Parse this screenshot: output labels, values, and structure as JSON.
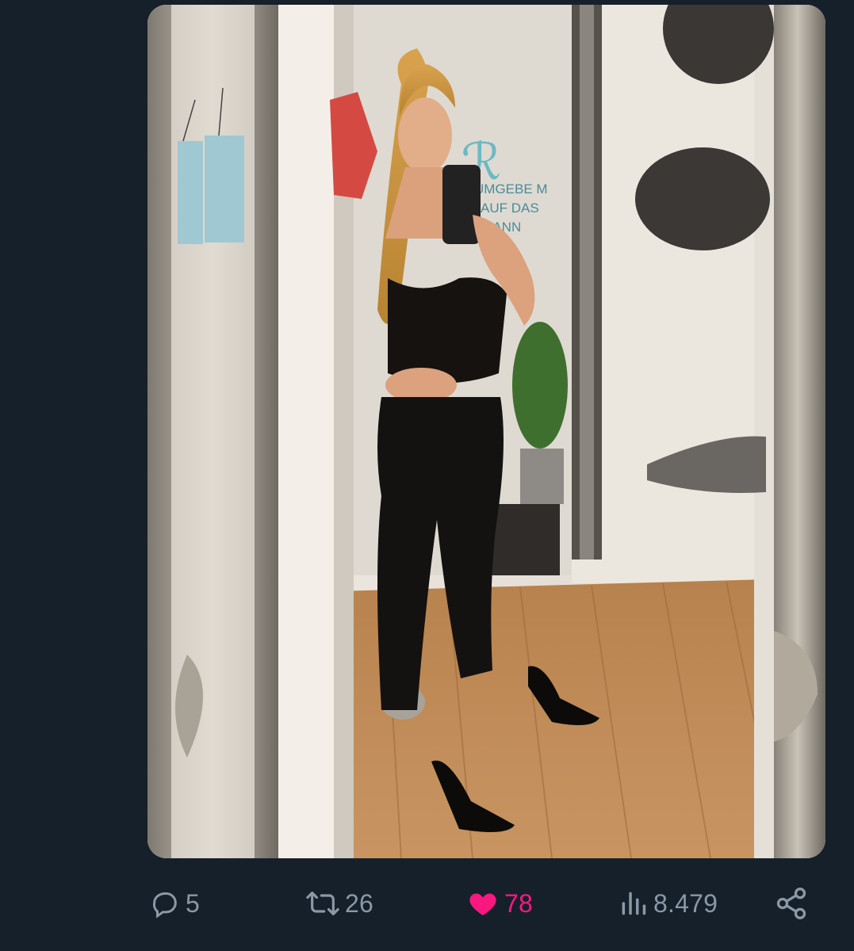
{
  "tweet": {
    "media": {
      "content": "mirror selfie photo",
      "wall_sign_lines": [
        "UMGEBE M",
        "AUF DAS",
        "KANN"
      ]
    },
    "actions": {
      "reply_count": "5",
      "retweet_count": "26",
      "like_count": "78",
      "views_count": "8.479"
    },
    "colors": {
      "background": "#15202b",
      "icon_gray": "#8b98a5",
      "like_pink": "#f91880"
    },
    "icons": {
      "reply": "reply-icon",
      "retweet": "retweet-icon",
      "like": "heart-icon",
      "views": "views-icon",
      "share": "share-icon"
    }
  }
}
